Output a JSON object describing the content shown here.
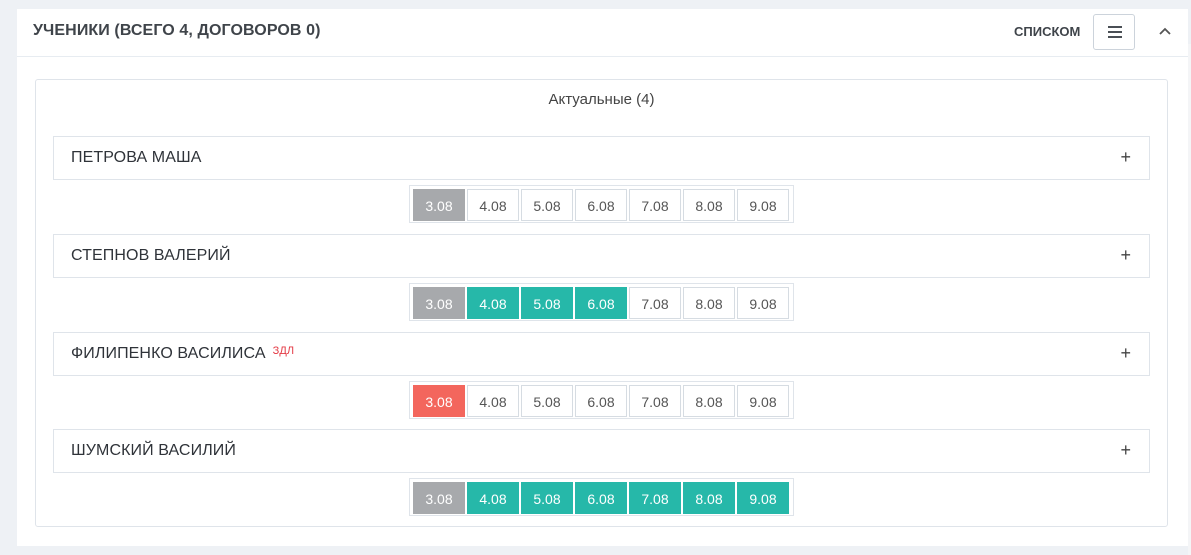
{
  "header": {
    "title": "УЧЕНИКИ (ВСЕГО 4, ДОГОВОРОВ 0)",
    "view_label": "СПИСКОМ",
    "menu_icon": "hamburger-icon",
    "collapse_icon": "chevron-up-icon"
  },
  "section": {
    "title": "Актуальные (4)"
  },
  "colors": {
    "past": "#a7a9ac",
    "present": "#26b8a9",
    "absent": "#f3665d",
    "empty": "#ffffff"
  },
  "students": [
    {
      "name": "ПЕТРОВА МАША",
      "tag": "",
      "expand_label": "+",
      "dates": [
        {
          "label": "3.08",
          "status": "past"
        },
        {
          "label": "4.08",
          "status": "empty"
        },
        {
          "label": "5.08",
          "status": "empty"
        },
        {
          "label": "6.08",
          "status": "empty"
        },
        {
          "label": "7.08",
          "status": "empty"
        },
        {
          "label": "8.08",
          "status": "empty"
        },
        {
          "label": "9.08",
          "status": "empty"
        }
      ]
    },
    {
      "name": "СТЕПНОВ ВАЛЕРИЙ",
      "tag": "",
      "expand_label": "+",
      "dates": [
        {
          "label": "3.08",
          "status": "past"
        },
        {
          "label": "4.08",
          "status": "present"
        },
        {
          "label": "5.08",
          "status": "present"
        },
        {
          "label": "6.08",
          "status": "present"
        },
        {
          "label": "7.08",
          "status": "empty"
        },
        {
          "label": "8.08",
          "status": "empty"
        },
        {
          "label": "9.08",
          "status": "empty"
        }
      ]
    },
    {
      "name": "ФИЛИПЕНКО ВАСИЛИСА",
      "tag": "ЗДЛ",
      "expand_label": "+",
      "dates": [
        {
          "label": "3.08",
          "status": "absent"
        },
        {
          "label": "4.08",
          "status": "empty"
        },
        {
          "label": "5.08",
          "status": "empty"
        },
        {
          "label": "6.08",
          "status": "empty"
        },
        {
          "label": "7.08",
          "status": "empty"
        },
        {
          "label": "8.08",
          "status": "empty"
        },
        {
          "label": "9.08",
          "status": "empty"
        }
      ]
    },
    {
      "name": "ШУМСКИЙ ВАСИЛИЙ",
      "tag": "",
      "expand_label": "+",
      "dates": [
        {
          "label": "3.08",
          "status": "past"
        },
        {
          "label": "4.08",
          "status": "present"
        },
        {
          "label": "5.08",
          "status": "present"
        },
        {
          "label": "6.08",
          "status": "present"
        },
        {
          "label": "7.08",
          "status": "present"
        },
        {
          "label": "8.08",
          "status": "present"
        },
        {
          "label": "9.08",
          "status": "present"
        }
      ]
    }
  ]
}
